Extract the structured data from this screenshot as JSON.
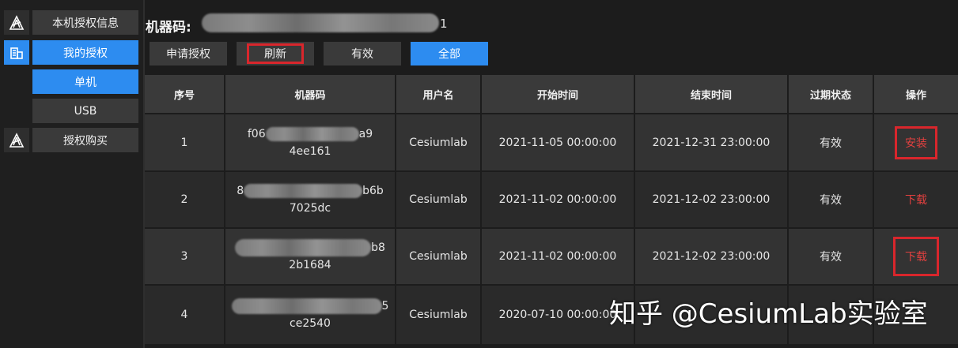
{
  "sidebar": {
    "items": [
      {
        "label": "本机授权信息",
        "icon": "logo-icon",
        "active": false
      },
      {
        "label": "我的授权",
        "icon": "building-icon",
        "active": true
      },
      {
        "label": "单机",
        "active": true
      },
      {
        "label": "USB",
        "active": false
      },
      {
        "label": "授权购买",
        "icon": "logo-icon",
        "active": false
      }
    ]
  },
  "header": {
    "machine_code_label": "机器码:",
    "machine_code_tail": "1"
  },
  "toolbar": {
    "apply_label": "申请授权",
    "refresh_label": "刷新",
    "valid_label": "有效",
    "all_label": "全部"
  },
  "table": {
    "headers": [
      "序号",
      "机器码",
      "用户名",
      "开始时间",
      "结束时间",
      "过期状态",
      "操作"
    ],
    "rows": [
      {
        "index": "1",
        "code_line1": "f06",
        "code_line1_end": "a9",
        "code_line2": "4ee161",
        "user": "Cesiumlab",
        "start": "2021-11-05 00:00:00",
        "end": "2021-12-31 23:00:00",
        "status": "有效",
        "action": "安装"
      },
      {
        "index": "2",
        "code_line1": "8",
        "code_line1_end": "b6b",
        "code_line2": "7025dc",
        "user": "Cesiumlab",
        "start": "2021-11-02 00:00:00",
        "end": "2021-12-02 23:00:00",
        "status": "有效",
        "action": "下载"
      },
      {
        "index": "3",
        "code_line1": "",
        "code_line1_end": "b8",
        "code_line2": "2b1684",
        "user": "Cesiumlab",
        "start": "2021-11-02 00:00:00",
        "end": "2021-12-02 23:00:00",
        "status": "有效",
        "action": "下载"
      },
      {
        "index": "4",
        "code_line1": "",
        "code_line1_end": "5",
        "code_line2": "ce2540",
        "user": "Cesiumlab",
        "start": "2020-07-10 00:00:00",
        "end": "",
        "status": "",
        "action": ""
      }
    ]
  },
  "watermark": "知乎 @CesiumLab实验室",
  "colors": {
    "accent": "#2d8cf0",
    "highlight_red": "#d9262c",
    "action_text": "#e0403f"
  }
}
